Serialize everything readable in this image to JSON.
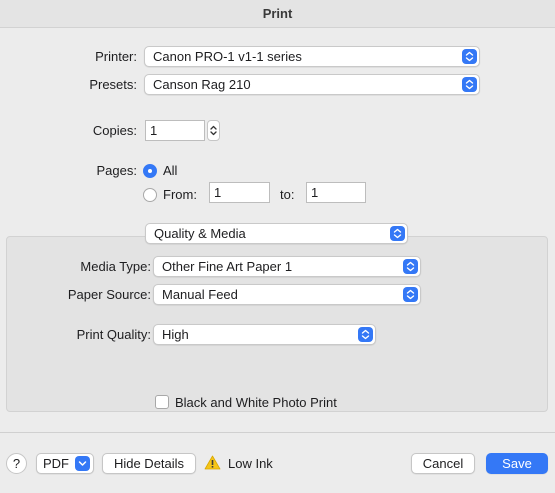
{
  "window": {
    "title": "Print"
  },
  "printer": {
    "label": "Printer:",
    "value": "Canon PRO-1 v1-1 series"
  },
  "presets": {
    "label": "Presets:",
    "value": "Canson Rag 210"
  },
  "copies": {
    "label": "Copies:",
    "value": "1"
  },
  "pages": {
    "label": "Pages:",
    "all_label": "All",
    "from_label": "From:",
    "from_value": "1",
    "to_label": "to:",
    "to_value": "1",
    "selected": "All"
  },
  "section": {
    "value": "Quality & Media"
  },
  "media_type": {
    "label": "Media Type:",
    "value": "Other Fine Art Paper 1"
  },
  "paper_source": {
    "label": "Paper Source:",
    "value": "Manual Feed"
  },
  "print_quality": {
    "label": "Print Quality:",
    "value": "High"
  },
  "bw_photo": {
    "label": "Black and White Photo Print",
    "checked": false
  },
  "footer": {
    "help_label": "?",
    "pdf_label": "PDF",
    "hide_details_label": "Hide Details",
    "warning_text": "Low Ink",
    "cancel_label": "Cancel",
    "save_label": "Save"
  },
  "colors": {
    "accent": "#3478f6",
    "background": "#ececec",
    "panel": "#e3e3e3",
    "warning": "#f5c518"
  }
}
